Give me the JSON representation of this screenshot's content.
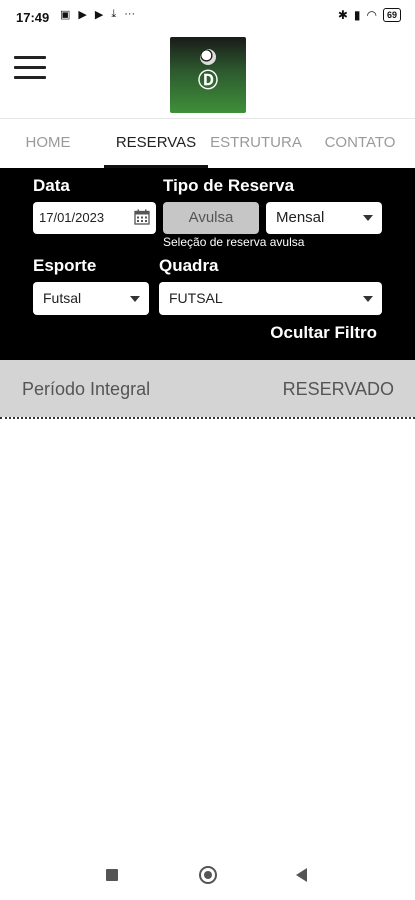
{
  "status_bar": {
    "time": "17:49",
    "battery": "69"
  },
  "tabs": [
    {
      "label": "HOME"
    },
    {
      "label": "RESERVAS"
    },
    {
      "label": "ESTRUTURA"
    },
    {
      "label": "CONTATO"
    }
  ],
  "active_tab": "RESERVAS",
  "filter": {
    "date_label": "Data",
    "date_value": "17/01/2023",
    "type_label": "Tipo de Reserva",
    "type_options": [
      "Avulsa",
      "Mensal"
    ],
    "type_selected": "Avulsa",
    "type_hint": "Seleção de reserva avulsa",
    "sport_label": "Esporte",
    "sport_value": "Futsal",
    "court_label": "Quadra",
    "court_value": "FUTSAL",
    "hide_filter": "Ocultar Filtro"
  },
  "reservation": {
    "period": "Período Integral",
    "status": "RESERVADO"
  },
  "colors": {
    "filter_bg": "#000000",
    "row_bg": "#d4d4d4",
    "avulsa_bg": "#c6c6c6"
  },
  "icons": [
    "menu-icon",
    "calendar-icon",
    "chevron-down-icon",
    "recent-apps-icon",
    "home-icon",
    "back-icon"
  ]
}
